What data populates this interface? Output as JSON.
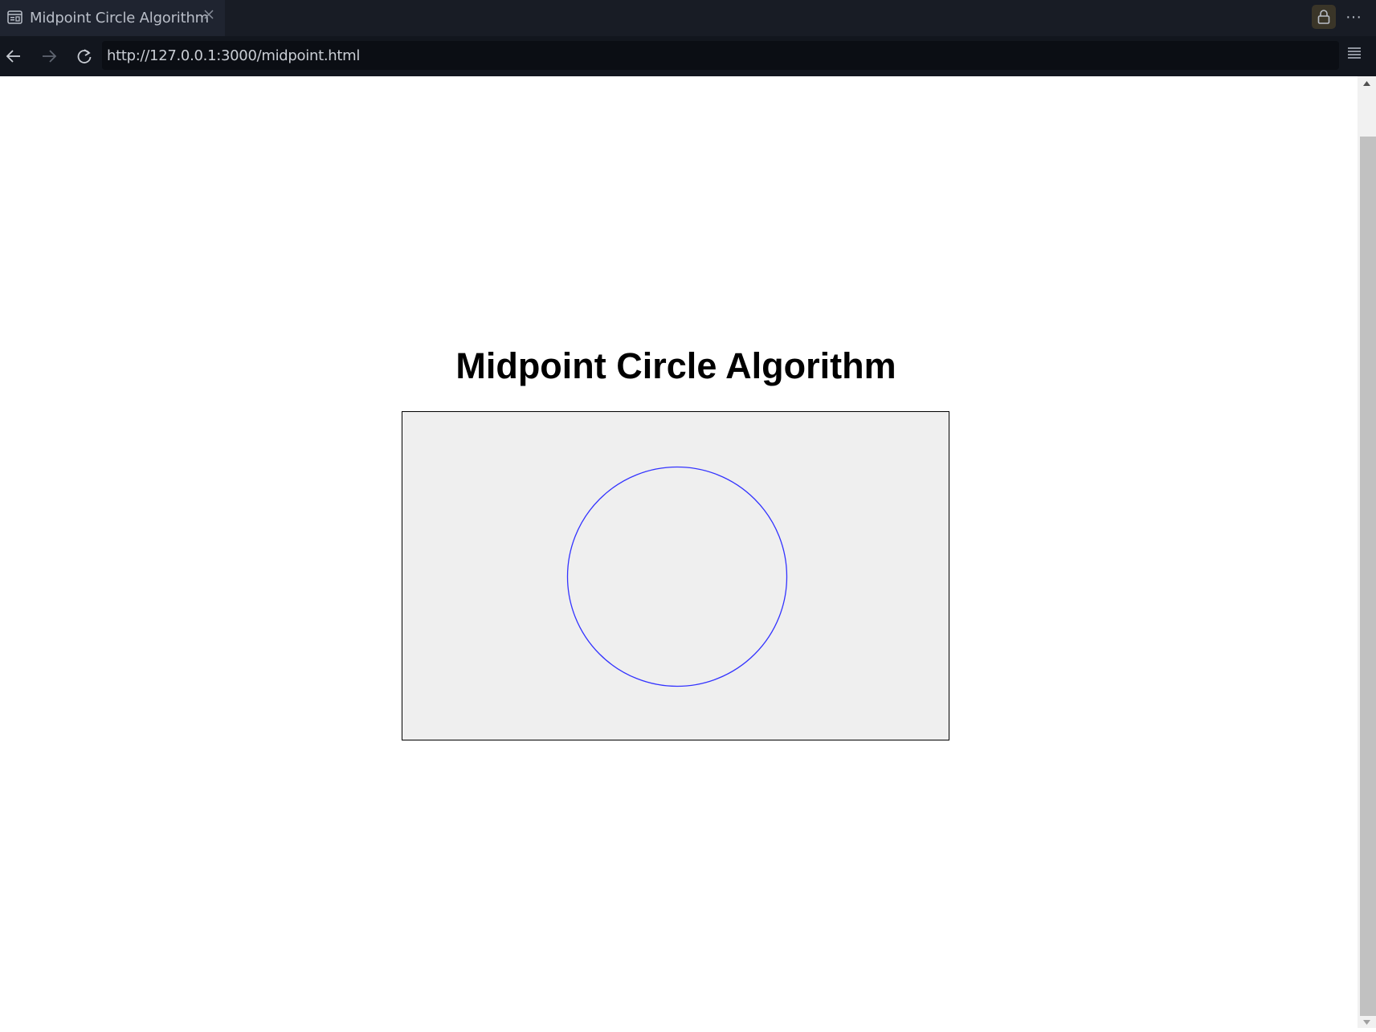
{
  "browser": {
    "tab": {
      "title": "Midpoint Circle Algorithm",
      "icon": "page-icon",
      "close_icon": "close-icon"
    },
    "toolbar": {
      "back_icon": "arrow-left-icon",
      "forward_icon": "arrow-right-icon",
      "reload_icon": "reload-icon",
      "url": "http://127.0.0.1:3000/midpoint.html",
      "menu_icon": "menu-icon",
      "lock_icon": "lock-icon",
      "more_label": "···"
    }
  },
  "page": {
    "title": "Midpoint Circle Algorithm",
    "canvas": {
      "background": "#efefef",
      "border_color": "#000000",
      "circle_color": "#3333ff"
    }
  },
  "colors": {
    "tabbar_bg": "#181c25",
    "navbar_bg": "#12161e",
    "accent_lock_bg": "#3a3528"
  }
}
